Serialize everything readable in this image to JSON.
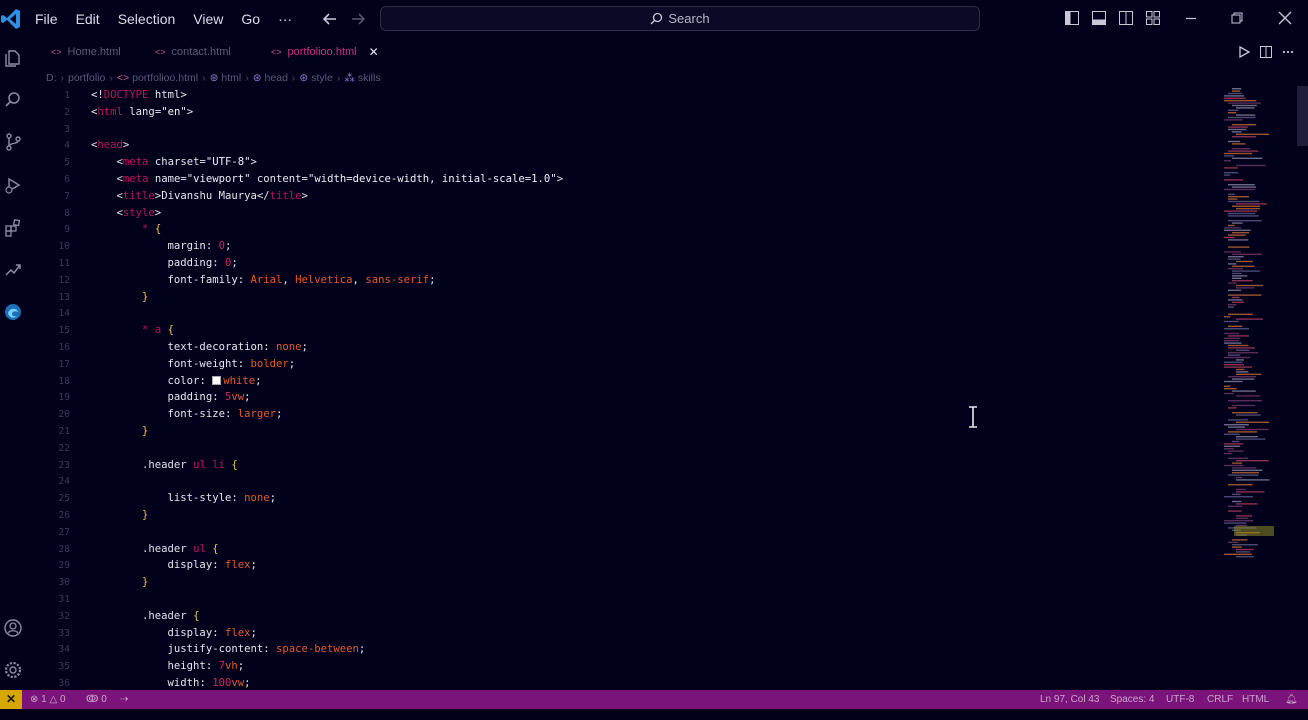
{
  "menu": [
    "File",
    "Edit",
    "Selection",
    "View",
    "Go",
    "···"
  ],
  "search": {
    "label": "Search"
  },
  "tabs": [
    {
      "label": "Home.html",
      "active": false
    },
    {
      "label": "contact.html",
      "active": false
    },
    {
      "label": "portfolioo.html",
      "active": true
    }
  ],
  "breadcrumb": [
    "D:",
    "portfolio",
    "portfolioo.html",
    "html",
    "head",
    "style",
    "skills"
  ],
  "code": [
    "<!DOCTYPE html>",
    "<html lang=\"en\">",
    "",
    "<head>",
    "    <meta charset=\"UTF-8\">",
    "    <meta name=\"viewport\" content=\"width=device-width, initial-scale=1.0\">",
    "    <title>Divanshu Maurya</title>",
    "    <style>",
    "        * {",
    "            margin: 0;",
    "            padding: 0;",
    "            font-family: Arial, Helvetica, sans-serif;",
    "        }",
    "",
    "        * a {",
    "            text-decoration: none;",
    "            font-weight: bolder;",
    "            color: white;",
    "            padding: 5vw;",
    "            font-size: larger;",
    "        }",
    "",
    "        .header ul li {",
    "",
    "            list-style: none;",
    "        }",
    "",
    "        .header ul {",
    "            display: flex;",
    "        }",
    "",
    "        .header {",
    "            display: flex;",
    "            justify-content: space-between;",
    "            height: 7vh;",
    "            width: 100vw;"
  ],
  "status": {
    "errors": "1",
    "warnings": "0",
    "ports": "0",
    "position": "Ln 97, Col 43",
    "spaces": "Spaces: 4",
    "encoding": "UTF-8",
    "eol": "CRLF",
    "language": "HTML"
  },
  "colors": {
    "background": "#01011c",
    "statusbar": "#7a137a",
    "remote": "#d5a700",
    "tag": "#b8185a",
    "value": "#e35c2e",
    "brace": "#f2c14a"
  }
}
